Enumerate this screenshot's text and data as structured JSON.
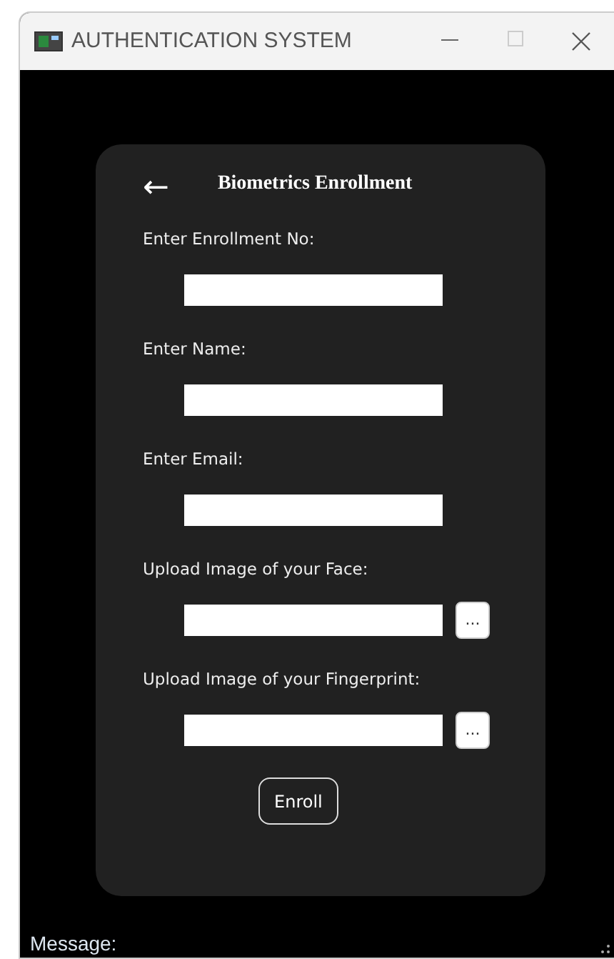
{
  "window": {
    "title": "AUTHENTICATION SYSTEM"
  },
  "form": {
    "back": "←",
    "title": "Biometrics Enrollment",
    "fields": [
      {
        "kind": "text",
        "label": "Enter Enrollment No:"
      },
      {
        "kind": "text",
        "label": "Enter Name:"
      },
      {
        "kind": "text",
        "label": "Enter Email:"
      },
      {
        "kind": "file",
        "label": "Upload Image of your Face:",
        "browse": "..."
      },
      {
        "kind": "file",
        "label": "Upload Image of your Fingerprint:",
        "browse": "..."
      }
    ],
    "submit": "Enroll"
  },
  "status": {
    "label": "Message:"
  }
}
